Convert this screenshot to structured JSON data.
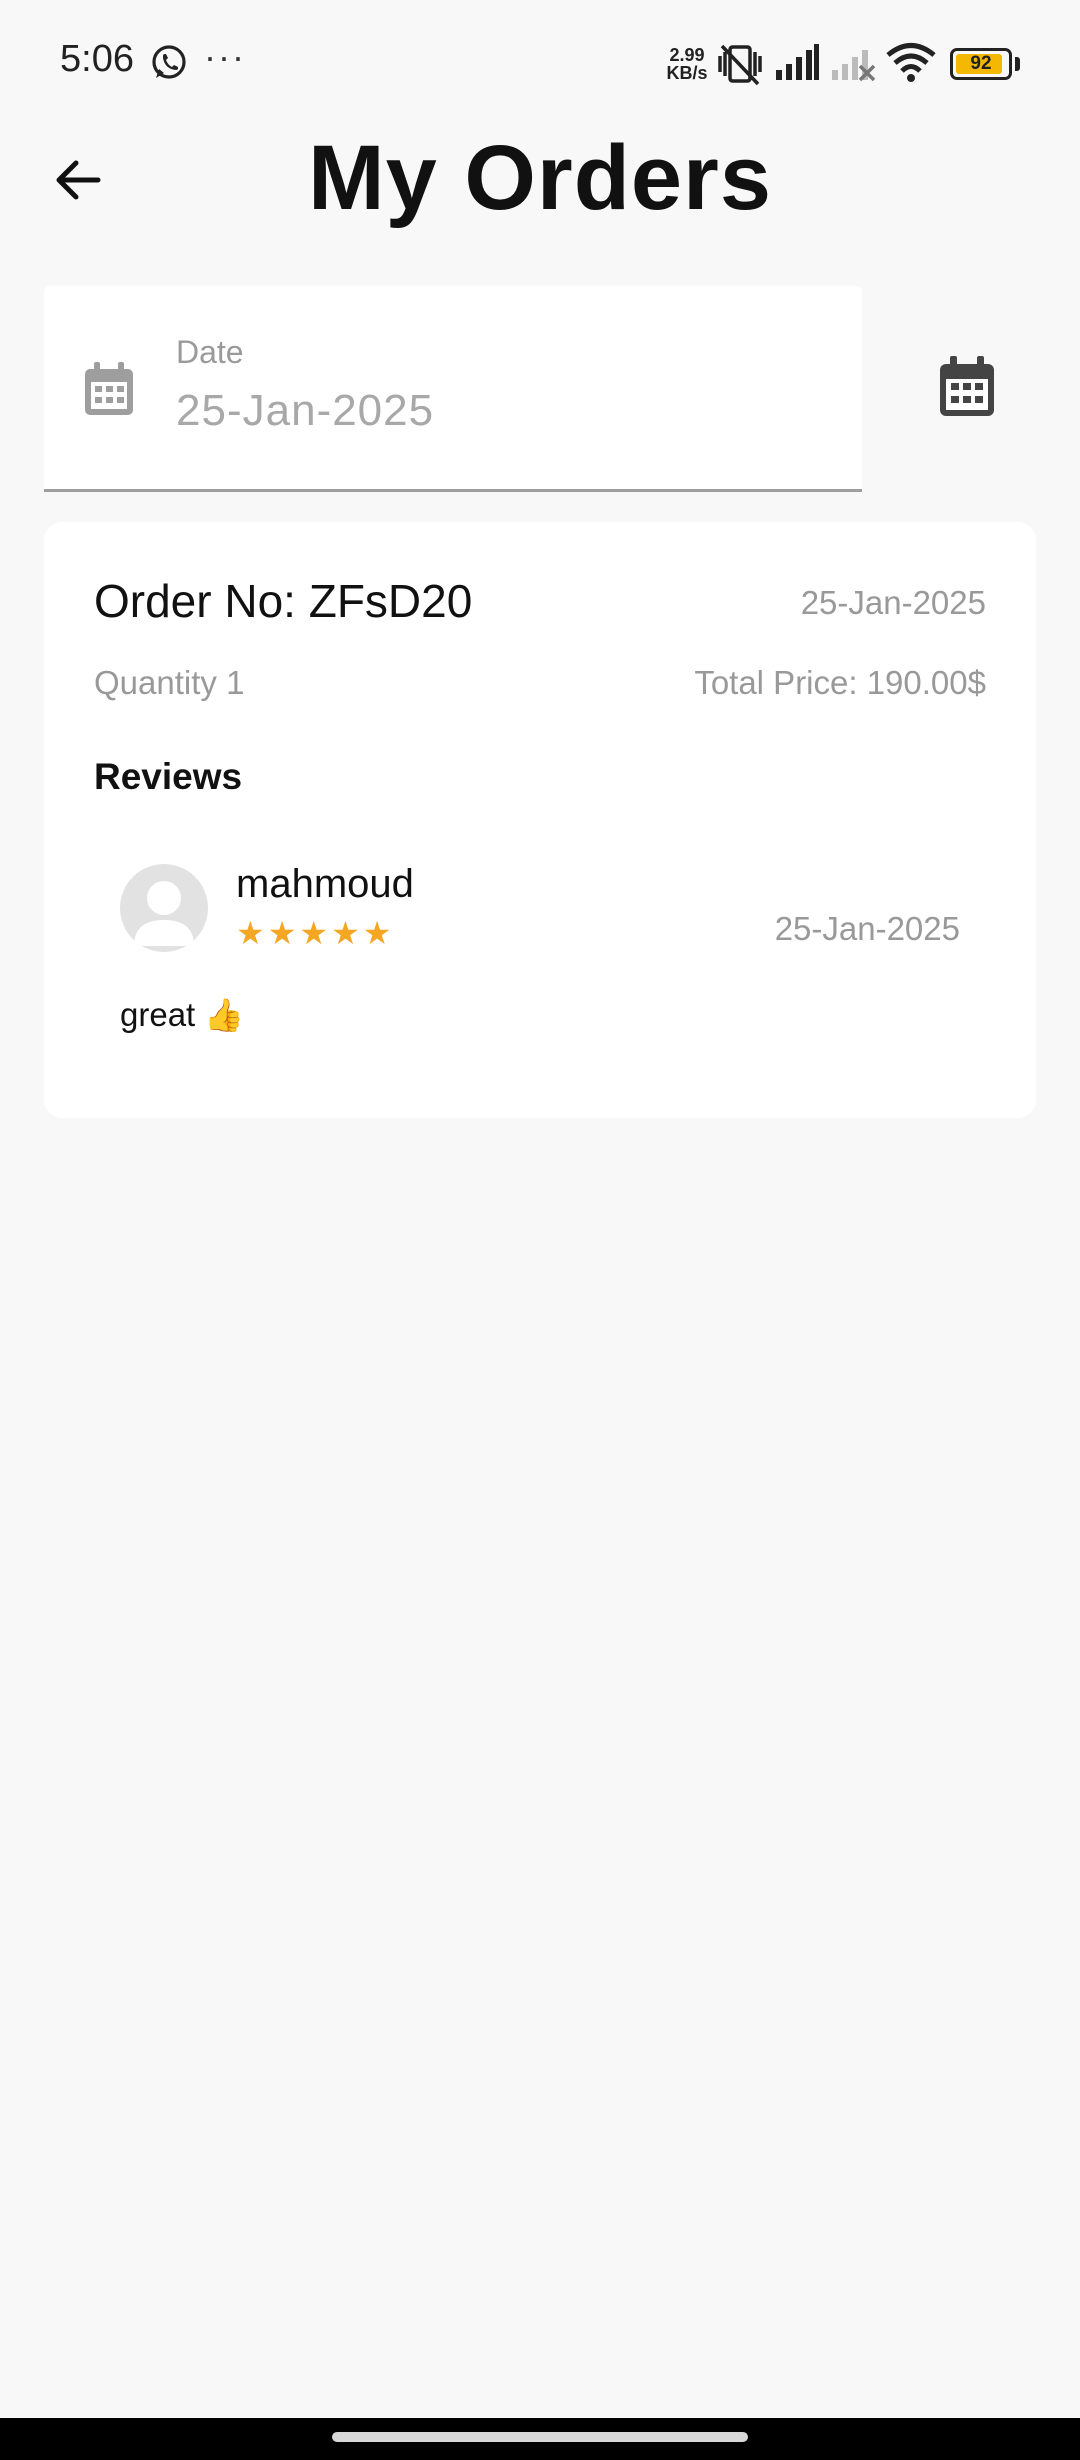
{
  "status_bar": {
    "time": "5:06",
    "dots": "···",
    "speed_value": "2.99",
    "speed_unit": "KB/s",
    "battery": "92",
    "battery_level": 0.92,
    "icons": [
      "whatsapp-icon",
      "more-dots-icon",
      "mute-vibrate-icon",
      "signal-icon",
      "signal-no-service-icon",
      "wifi-icon",
      "battery-icon"
    ]
  },
  "header": {
    "title": "My Orders",
    "back_icon": "arrow-left-icon"
  },
  "date_filter": {
    "label": "Date",
    "value": "25-Jan-2025",
    "field_icon": "calendar-icon",
    "button_icon": "calendar-icon"
  },
  "order": {
    "order_no": "Order No: ZFsD20",
    "date": "25-Jan-2025",
    "quantity": "Quantity 1",
    "total_price": "Total Price: 190.00$",
    "reviews_heading": "Reviews",
    "reviews": [
      {
        "name": "mahmoud",
        "rating": 5,
        "date": "25-Jan-2025",
        "text": "great",
        "emoji": "👍"
      }
    ]
  },
  "colors": {
    "background": "#f8f8f8",
    "card": "#ffffff",
    "star": "#f5a623",
    "muted_text": "#999999",
    "battery_fill": "#f5b800"
  }
}
